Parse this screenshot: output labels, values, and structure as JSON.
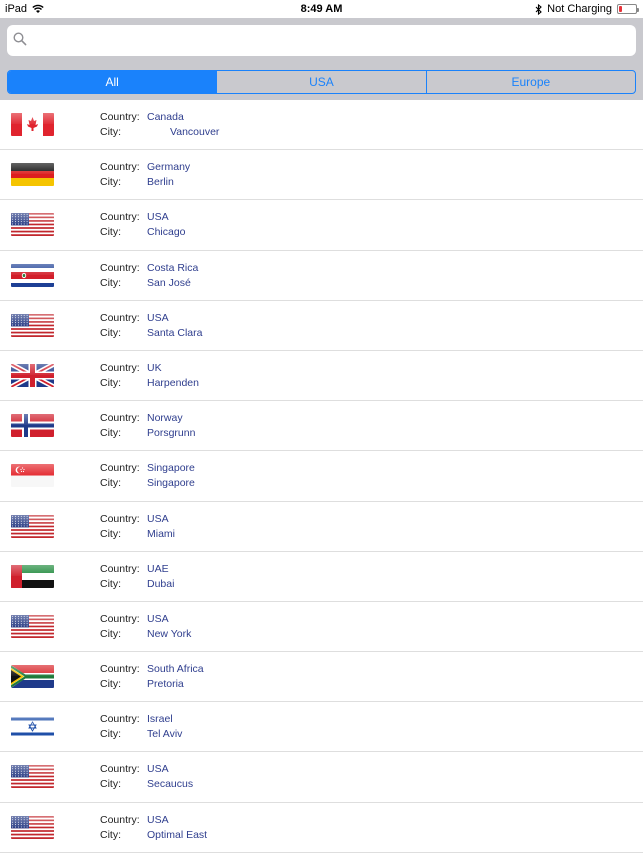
{
  "status_bar": {
    "device": "iPad",
    "time": "8:49 AM",
    "charging": "Not Charging"
  },
  "search": {
    "placeholder": "",
    "value": ""
  },
  "segments": [
    {
      "label": "All",
      "selected": true
    },
    {
      "label": "USA",
      "selected": false
    },
    {
      "label": "Europe",
      "selected": false
    }
  ],
  "labels": {
    "country": "Country:",
    "city": "City:"
  },
  "colors": {
    "accent": "#1a82fb",
    "value_text": "#2f3e8e",
    "bar_bg": "#c9c9ce"
  },
  "entries": [
    {
      "flag": "canada-flag-icon",
      "country": "Canada",
      "city": "Vancouver",
      "city_indented": true
    },
    {
      "flag": "germany-flag-icon",
      "country": "Germany",
      "city": "Berlin"
    },
    {
      "flag": "usa-flag-icon",
      "country": "USA",
      "city": "Chicago"
    },
    {
      "flag": "costa-rica-flag-icon",
      "country": "Costa Rica",
      "city": "San José"
    },
    {
      "flag": "usa-flag-icon",
      "country": "USA",
      "city": "Santa Clara"
    },
    {
      "flag": "uk-flag-icon",
      "country": "UK",
      "city": "Harpenden"
    },
    {
      "flag": "norway-flag-icon",
      "country": "Norway",
      "city": "Porsgrunn"
    },
    {
      "flag": "singapore-flag-icon",
      "country": "Singapore",
      "city": "Singapore"
    },
    {
      "flag": "usa-flag-icon",
      "country": "USA",
      "city": "Miami"
    },
    {
      "flag": "uae-flag-icon",
      "country": "UAE",
      "city": "Dubai"
    },
    {
      "flag": "usa-flag-icon",
      "country": "USA",
      "city": "New York"
    },
    {
      "flag": "south-africa-flag-icon",
      "country": "South Africa",
      "city": "Pretoria"
    },
    {
      "flag": "israel-flag-icon",
      "country": "Israel",
      "city": "Tel Aviv"
    },
    {
      "flag": "usa-flag-icon",
      "country": "USA",
      "city": "Secaucus"
    },
    {
      "flag": "usa-flag-icon",
      "country": "USA",
      "city": "Optimal East"
    }
  ]
}
